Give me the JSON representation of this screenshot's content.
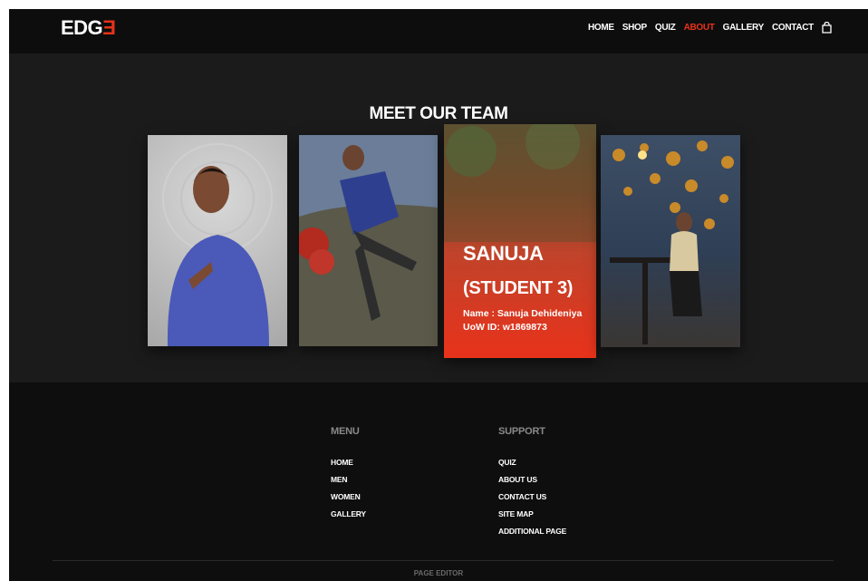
{
  "brand": {
    "logo_main": "EDG",
    "logo_accent": "Ǝ"
  },
  "nav": {
    "items": [
      {
        "label": "HOME"
      },
      {
        "label": "SHOP"
      },
      {
        "label": "QUIZ"
      },
      {
        "label": "ABOUT",
        "active": true
      },
      {
        "label": "GALLERY"
      },
      {
        "label": "CONTACT"
      }
    ],
    "cart_icon": "shopping-bag-icon"
  },
  "team": {
    "title": "MEET OUR TEAM",
    "featured": {
      "name": "SANUJA",
      "role": "(STUDENT 3)",
      "line1": "Name : Sanuja Dehideniya",
      "line2": "UoW ID: w1869873"
    }
  },
  "footer": {
    "menu": {
      "heading": "MENU",
      "items": [
        "HOME",
        "MEN",
        "WOMEN",
        "GALLERY"
      ]
    },
    "support": {
      "heading": "SUPPORT",
      "items": [
        "QUIZ",
        "ABOUT US",
        "CONTACT US",
        "SITE MAP",
        "ADDITIONAL PAGE"
      ]
    },
    "credit": "PAGE EDITOR"
  },
  "colors": {
    "accent": "#e8321b",
    "background": "#1a1a1a",
    "nav_bg": "#0d0d0d",
    "footer_bg": "#0e0e0e"
  }
}
